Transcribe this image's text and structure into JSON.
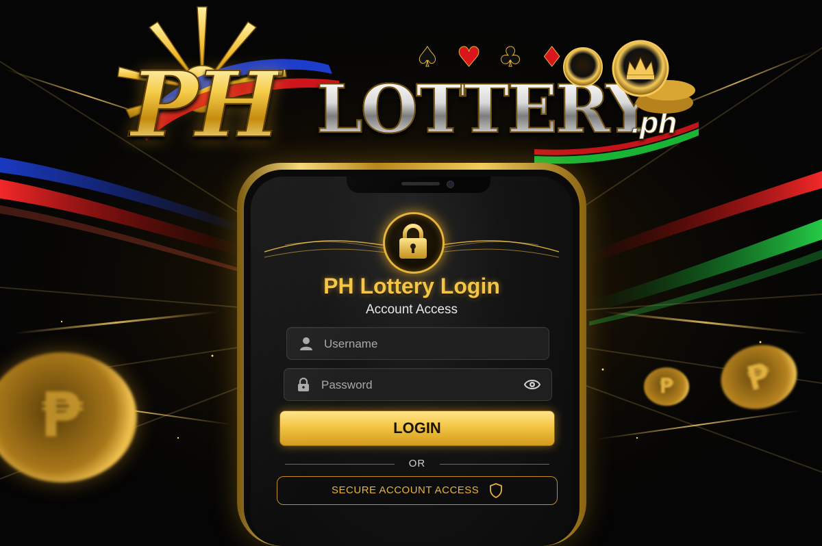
{
  "logo": {
    "brand_main": "PH",
    "brand_word": "LOTTERY",
    "brand_tld": ".ph",
    "suits": [
      "♠",
      "♥",
      "♣",
      "♦"
    ]
  },
  "login": {
    "title": "PH Lottery Login",
    "subtitle": "Account Access",
    "username_placeholder": "Username",
    "password_placeholder": "Password",
    "login_button": "LOGIN",
    "divider_text": "OR",
    "secure_button": "SECURE ACCOUNT ACCESS"
  },
  "coins": {
    "symbol": "₱"
  },
  "colors": {
    "gold": "#f3c545",
    "dark_gold": "#c48f1c",
    "flag_blue": "#1d3fd6",
    "flag_red": "#d8161c",
    "flag_green": "#19b336",
    "background": "#050505"
  },
  "icons": {
    "lock": "lock-icon",
    "user": "user-icon",
    "password": "lock-icon",
    "show_password": "eye-icon",
    "secure": "shield-icon"
  }
}
